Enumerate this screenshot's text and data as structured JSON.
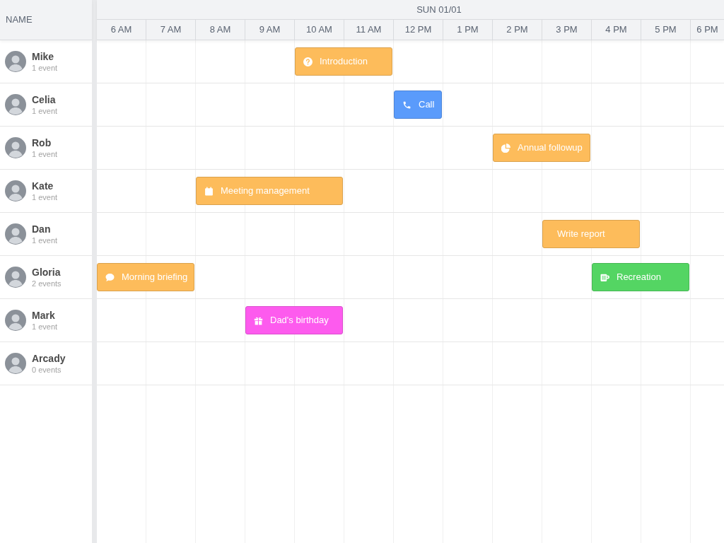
{
  "name_column": {
    "header": "NAME"
  },
  "day": {
    "label": "SUN 01/01"
  },
  "hours": [
    "6 AM",
    "7 AM",
    "8 AM",
    "9 AM",
    "10 AM",
    "11 AM",
    "12 PM",
    "1 PM",
    "2 PM",
    "3 PM",
    "4 PM",
    "5 PM",
    "6 PM"
  ],
  "people": [
    {
      "name": "Mike",
      "count": "1 event",
      "slots": [
        {
          "kind": "free"
        },
        {
          "kind": "free"
        },
        {
          "kind": "free"
        },
        {
          "kind": "free"
        },
        {
          "kind": "event",
          "event": {
            "title": "Introduction",
            "kind": "question",
            "color": "#fdbc5b"
          }
        },
        {
          "kind": "continued"
        }
      ]
    },
    {
      "name": "Celia",
      "count": "1 event",
      "slots": [
        {
          "kind": "free"
        },
        {
          "kind": "free"
        },
        {
          "kind": "free"
        },
        {
          "kind": "free"
        },
        {
          "kind": "free"
        },
        {
          "kind": "free"
        },
        {
          "kind": "event",
          "event": {
            "title": "Call",
            "kind": "phone",
            "color": "#5a9bfb"
          }
        }
      ]
    },
    {
      "name": "Rob",
      "count": "1 event",
      "slots": [
        {
          "kind": "free"
        },
        {
          "kind": "free"
        },
        {
          "kind": "free"
        },
        {
          "kind": "free"
        },
        {
          "kind": "free"
        },
        {
          "kind": "free"
        },
        {
          "kind": "free"
        },
        {
          "kind": "free"
        },
        {
          "kind": "event",
          "event": {
            "title": "Annual followup",
            "kind": "pie",
            "color": "#fdbc5b"
          }
        },
        {
          "kind": "continued"
        }
      ]
    },
    {
      "name": "Kate",
      "count": "1 event",
      "slots": [
        {
          "kind": "free"
        },
        {
          "kind": "free"
        },
        {
          "kind": "event",
          "event": {
            "title": "Meeting management",
            "kind": "calendar",
            "color": "#fdbc5b"
          }
        },
        {
          "kind": "continued"
        },
        {
          "kind": "continued"
        }
      ]
    },
    {
      "name": "Dan",
      "count": "1 event",
      "slots": [
        {
          "kind": "free"
        },
        {
          "kind": "free"
        },
        {
          "kind": "free"
        },
        {
          "kind": "free"
        },
        {
          "kind": "free"
        },
        {
          "kind": "free"
        },
        {
          "kind": "free"
        },
        {
          "kind": "free"
        },
        {
          "kind": "free"
        },
        {
          "kind": "event",
          "event": {
            "title": "Write report",
            "kind": "plain",
            "color": "#fdbc5b"
          }
        },
        {
          "kind": "continued"
        }
      ]
    },
    {
      "name": "Gloria",
      "count": "2 events",
      "slots": [
        {
          "kind": "event",
          "event": {
            "title": "Morning briefing",
            "kind": "chat",
            "color": "#fdbc5b"
          }
        },
        {
          "kind": "continued"
        },
        {
          "kind": "free"
        },
        {
          "kind": "free"
        },
        {
          "kind": "free"
        },
        {
          "kind": "free"
        },
        {
          "kind": "free"
        },
        {
          "kind": "free"
        },
        {
          "kind": "free"
        },
        {
          "kind": "free"
        },
        {
          "kind": "event",
          "event": {
            "title": "Recreation",
            "kind": "mug",
            "color": "#54d563"
          }
        },
        {
          "kind": "continued"
        }
      ]
    },
    {
      "name": "Mark",
      "count": "1 event",
      "slots": [
        {
          "kind": "free"
        },
        {
          "kind": "free"
        },
        {
          "kind": "free"
        },
        {
          "kind": "event",
          "event": {
            "title": "Dad's birthday",
            "kind": "gift",
            "color": "#fd5bee"
          }
        },
        {
          "kind": "continued"
        }
      ]
    },
    {
      "name": "Arcady",
      "count": "0 events"
    }
  ]
}
